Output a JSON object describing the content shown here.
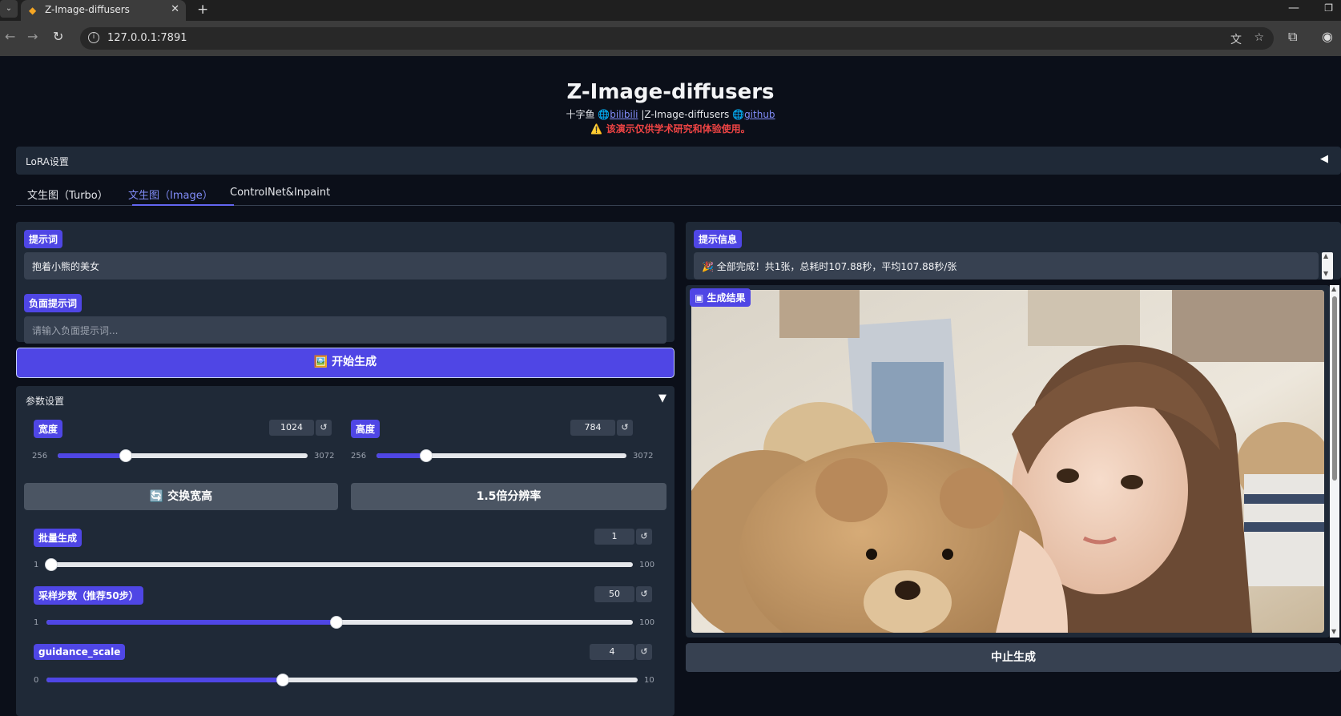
{
  "browser": {
    "tab_title": "Z-Image-diffusers",
    "url": "127.0.0.1:7891"
  },
  "header": {
    "title": "Z-Image-diffusers",
    "author": "十字鱼",
    "bilibili_link": "bilibili",
    "middle_text": "|Z-Image-diffusers",
    "github_link": "github",
    "warning": "该演示仅供学术研究和体验使用。"
  },
  "lora": {
    "label": "LoRA设置"
  },
  "tabs": [
    {
      "label": "文生图（Turbo）"
    },
    {
      "label": "文生图（Image）"
    },
    {
      "label": "ControlNet&Inpaint"
    }
  ],
  "prompt": {
    "label": "提示词",
    "value": "抱着小熊的美女",
    "neg_label": "负面提示词",
    "neg_placeholder": "请输入负面提示词..."
  },
  "generate_button": "🖼️ 开始生成",
  "params": {
    "title": "参数设置",
    "width": {
      "label": "宽度",
      "value": "1024",
      "min": "256",
      "max": "3072",
      "fraction": 0.273
    },
    "height": {
      "label": "高度",
      "value": "784",
      "min": "256",
      "max": "3072",
      "fraction": 0.198
    },
    "swap_button": "🔄 交换宽高",
    "upscale_button": "1.5倍分辨率",
    "batch": {
      "label": "批量生成",
      "value": "1",
      "min": "1",
      "max": "100",
      "fraction": 0.0
    },
    "steps": {
      "label": "采样步数（推荐50步）",
      "value": "50",
      "min": "1",
      "max": "100",
      "fraction": 0.495
    },
    "guidance": {
      "label": "guidance_scale",
      "value": "4",
      "min": "0",
      "max": "10",
      "fraction": 0.4
    }
  },
  "info": {
    "label": "提示信息",
    "message": "🎉 全部完成！共1张，总耗时107.88秒，平均107.88秒/张"
  },
  "result": {
    "label": "生成结果"
  },
  "stop_button": "中止生成",
  "colors": {
    "accent": "#4f46e5",
    "panel": "#1f2937",
    "bg": "#0b0f19",
    "warning": "#ef4444"
  }
}
